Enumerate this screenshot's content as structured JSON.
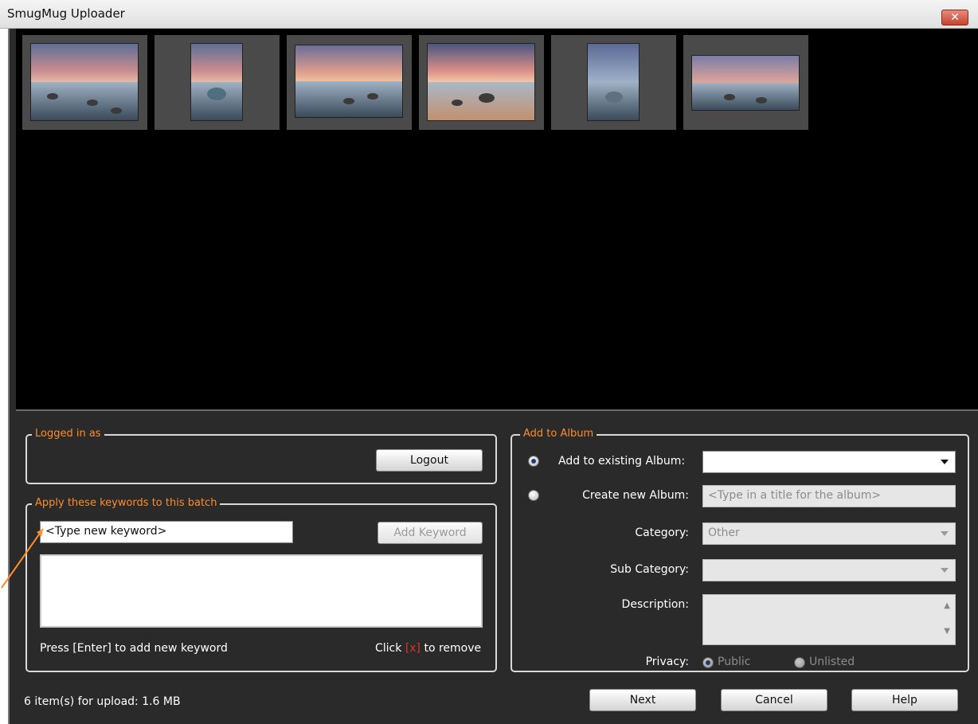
{
  "window": {
    "title": "SmugMug Uploader",
    "close_glyph": "✕"
  },
  "thumbnails": [
    {
      "name": "Thumbnail 1"
    },
    {
      "name": "Thumbnail 2"
    },
    {
      "name": "Thumbnail 3"
    },
    {
      "name": "Thumbnail 4"
    },
    {
      "name": "Thumbnail 5"
    },
    {
      "name": "Thumbnail 6"
    }
  ],
  "login": {
    "legend": "Logged in as",
    "logout_label": "Logout"
  },
  "keywords": {
    "legend": "Apply these keywords to this batch",
    "input_placeholder": "<Type new keyword>",
    "add_label": "Add Keyword",
    "hint_left": "Press [Enter] to add new keyword",
    "hint_right_prefix": "Click ",
    "hint_right_x": "[x]",
    "hint_right_suffix": " to remove"
  },
  "album": {
    "legend": "Add to Album",
    "existing_label": "Add to existing Album:",
    "existing_value": "",
    "new_label": "Create new Album:",
    "new_placeholder": "<Type in a title for the album>",
    "category_label": "Category:",
    "category_value": "Other",
    "subcategory_label": "Sub Category:",
    "subcategory_value": "",
    "description_label": "Description:",
    "privacy_label": "Privacy:",
    "privacy_public": "Public",
    "privacy_unlisted": "Unlisted"
  },
  "status": {
    "text": "6 item(s) for upload: 1.6 MB"
  },
  "footer": {
    "next_label": "Next",
    "cancel_label": "Cancel",
    "help_label": "Help"
  },
  "colors": {
    "accent": "#ff8c29",
    "background": "#2a2a2a",
    "preview": "#000000",
    "remove_x": "#e0322b"
  }
}
